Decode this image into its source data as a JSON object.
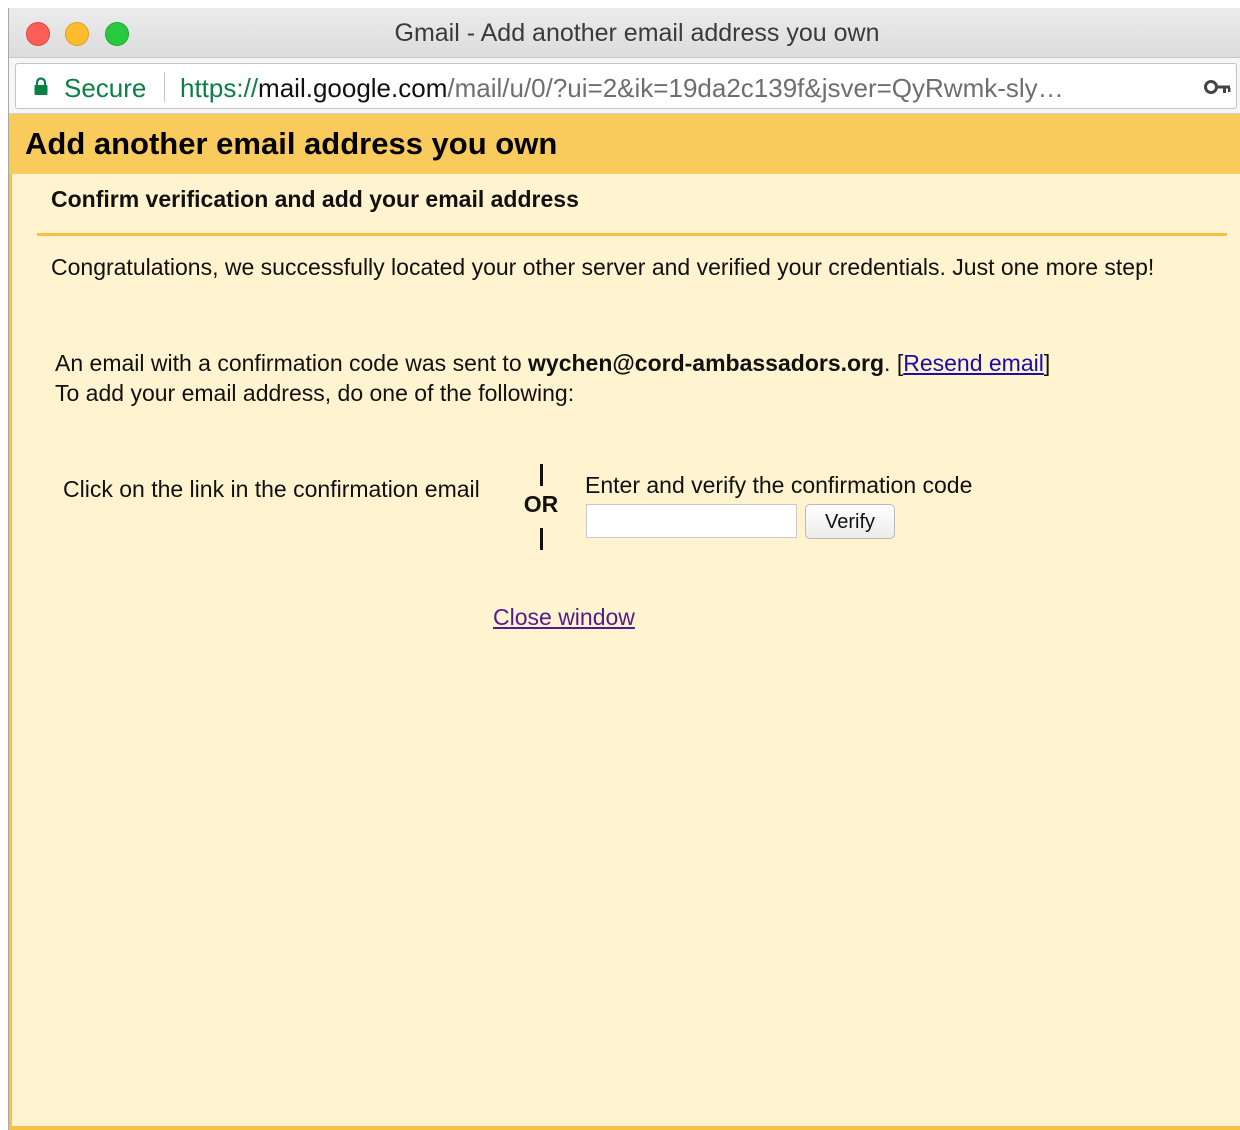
{
  "window": {
    "title": "Gmail - Add another email address you own"
  },
  "addressbar": {
    "secure_label": "Secure",
    "url_scheme": "https://",
    "url_host": "mail.google.com",
    "url_path": "/mail/u/0/?ui=2&ik=19da2c139f&jsver=QyRwmk-sly…",
    "icons": [
      "lock-icon",
      "key-icon"
    ]
  },
  "page": {
    "title": "Add another email address you own",
    "section_title": "Confirm verification and add your email address",
    "congrats": "Congratulations, we successfully located your other server and verified your credentials. Just one more step!",
    "sent_prefix": "An email with a confirmation code was sent to ",
    "sent_email": "wychen@cord-ambassadors.org",
    "sent_after_email": ". [",
    "resend_link": "Resend email",
    "sent_suffix": "]",
    "instructions": "To add your email address, do one of the following:",
    "option_link_text": "Click on the link in the confirmation email",
    "or_label": "OR",
    "code_label": "Enter and verify the confirmation code",
    "code_value": "",
    "verify_button": "Verify",
    "close_link": "Close window"
  },
  "colors": {
    "header_bg": "#f9cb5c",
    "page_bg": "#fff3d0",
    "secure_green": "#0b8043",
    "link_blue": "#1a0dab",
    "visited_purple": "#551a8b"
  }
}
